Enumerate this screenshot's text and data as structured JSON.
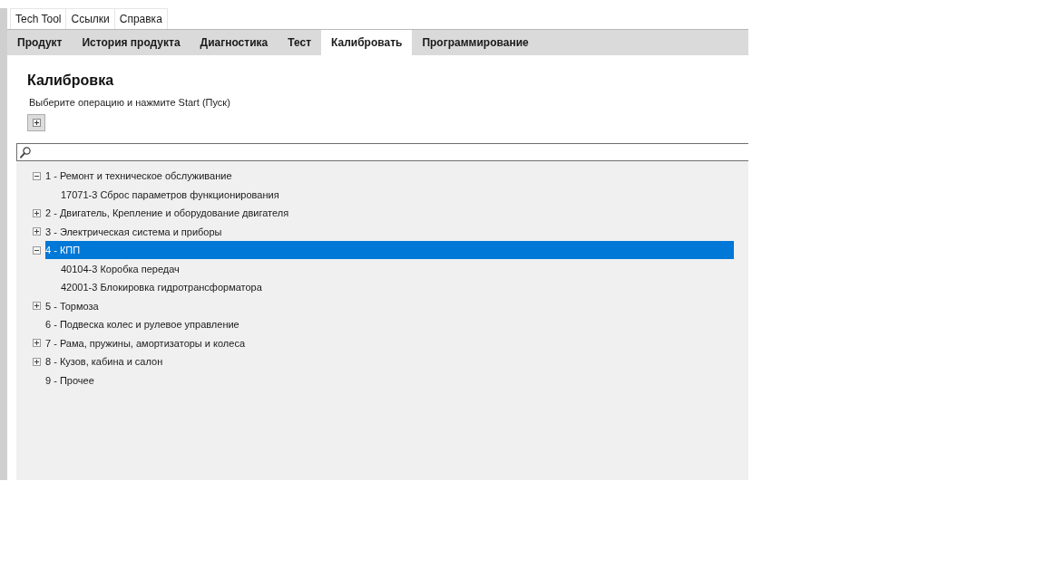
{
  "menu": [
    {
      "label": "Tech Tool"
    },
    {
      "label": "Ссылки"
    },
    {
      "label": "Справка"
    }
  ],
  "tabs": [
    {
      "label": "Продукт",
      "selected": false
    },
    {
      "label": "История продукта",
      "selected": false
    },
    {
      "label": "Диагностика",
      "selected": false
    },
    {
      "label": "Тест",
      "selected": false
    },
    {
      "label": "Калибровать",
      "selected": true
    },
    {
      "label": "Программирование",
      "selected": false
    }
  ],
  "page": {
    "title": "Калибровка",
    "instruction": "Выберите операцию и нажмите Start (Пуск)"
  },
  "tree": [
    {
      "kind": "group",
      "label": "1 - Ремонт и техническое обслуживание",
      "expanded": true,
      "selected": false,
      "children": [
        {
          "kind": "entry",
          "label": "17071-3 Сброс параметров функционирования",
          "selected": false
        }
      ]
    },
    {
      "kind": "group",
      "label": "2 - Двигатель, Крепление и оборудование двигателя",
      "expanded": false,
      "selected": false
    },
    {
      "kind": "group",
      "label": "3 - Электрическая система и приборы",
      "expanded": false,
      "selected": false
    },
    {
      "kind": "group",
      "label": "4 - КПП",
      "expanded": true,
      "selected": true,
      "children": [
        {
          "kind": "entry",
          "label": "40104-3 Коробка передач",
          "selected": false
        },
        {
          "kind": "entry",
          "label": "42001-3 Блокировка гидротрансформатора",
          "selected": false
        }
      ]
    },
    {
      "kind": "group",
      "label": "5 - Тормоза",
      "expanded": false,
      "selected": false
    },
    {
      "kind": "entry",
      "label": "6 - Подвеска колес и рулевое управление",
      "selected": false
    },
    {
      "kind": "group",
      "label": "7 - Рама, пружины, амортизаторы и колеса",
      "expanded": false,
      "selected": false
    },
    {
      "kind": "group",
      "label": "8 - Кузов, кабина и салон",
      "expanded": false,
      "selected": false
    },
    {
      "kind": "entry",
      "label": "9 - Прочее",
      "selected": false
    }
  ]
}
